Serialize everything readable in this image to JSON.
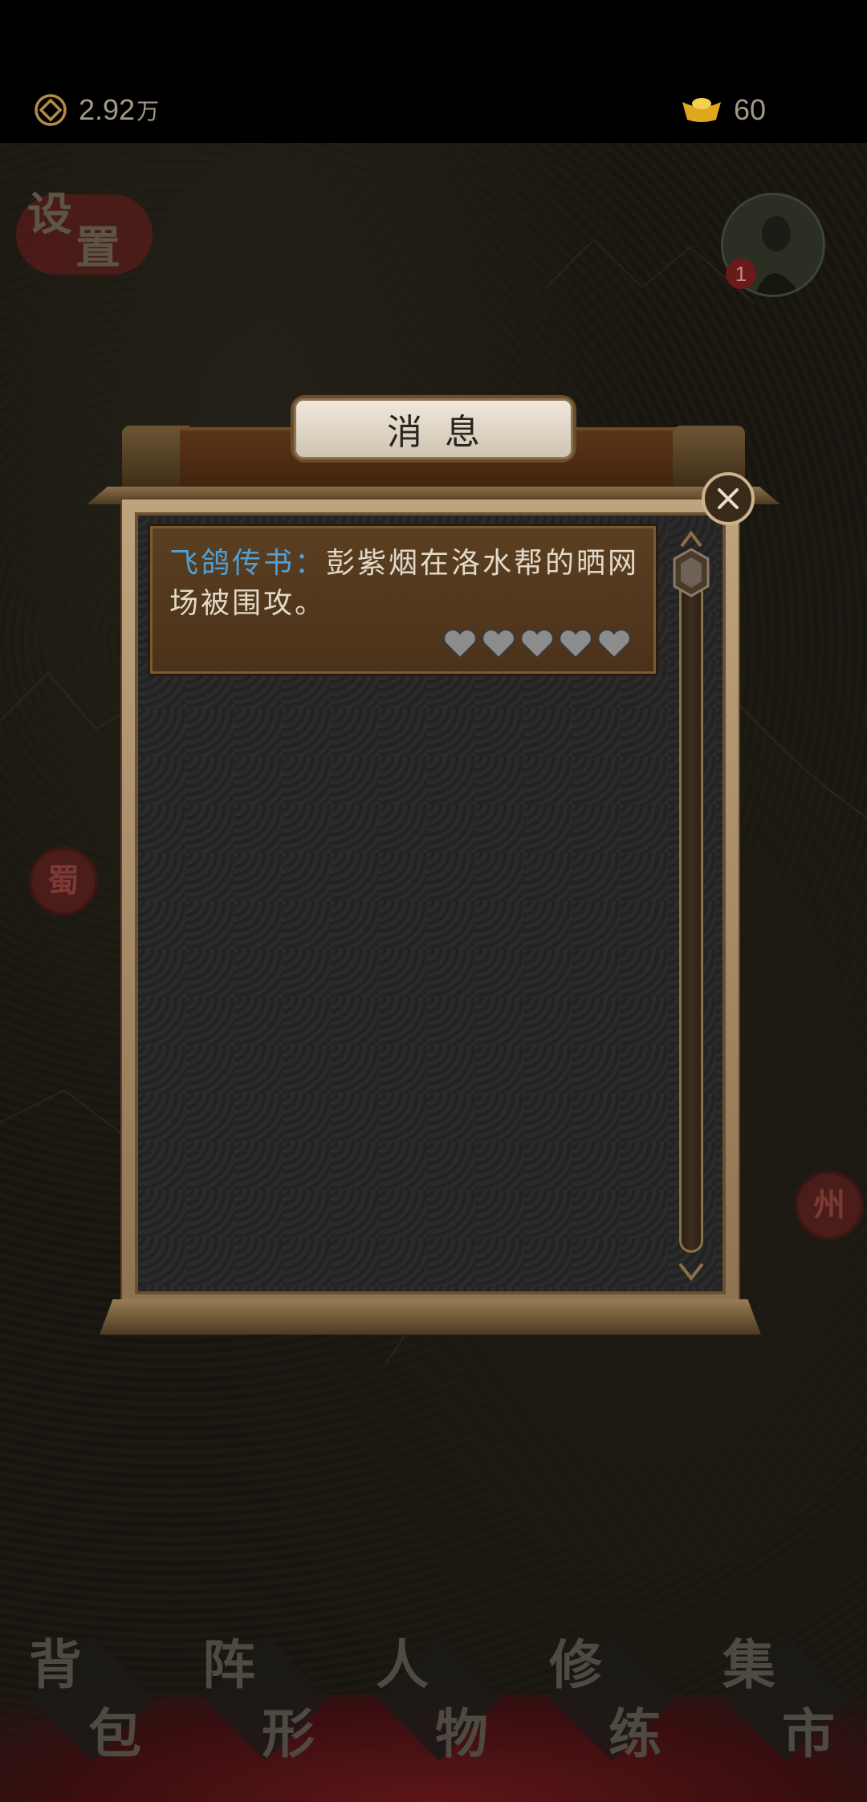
{
  "status_bar": {
    "coins_value": "2.92",
    "coins_unit": "万",
    "gold_ingots": "60"
  },
  "map": {
    "settings_label_1": "设",
    "settings_label_2": "置",
    "notification_count": "1",
    "region_seal_left": "蜀",
    "region_seal_right": "州"
  },
  "dialog": {
    "title": "消息",
    "messages": [
      {
        "sender": "飞鸽传书：",
        "text": "彭紫烟在洛水帮的晒网场被围攻。",
        "hearts_filled": 0,
        "hearts_total": 5
      }
    ]
  },
  "bottom_nav": [
    {
      "c1": "背",
      "c2": "包"
    },
    {
      "c1": "阵",
      "c2": "形"
    },
    {
      "c1": "人",
      "c2": "物"
    },
    {
      "c1": "修",
      "c2": "练"
    },
    {
      "c1": "集",
      "c2": "市"
    }
  ],
  "colors": {
    "sender": "#4fa0d8",
    "message_text": "#e3d9c8",
    "frame": "#bfa57e"
  }
}
